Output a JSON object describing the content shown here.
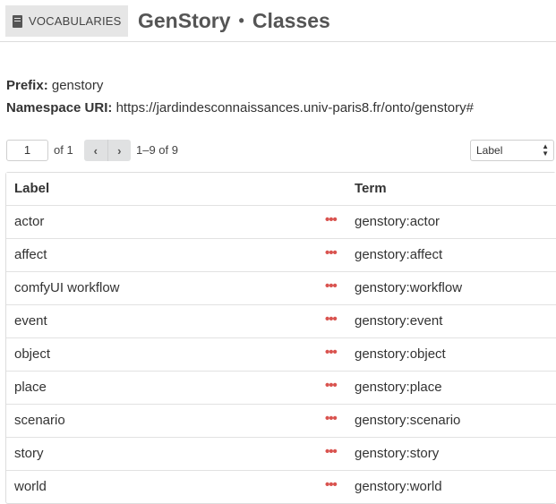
{
  "header": {
    "vocab_button_label": "VOCABULARIES",
    "title_name": "GenStory",
    "title_separator": "•",
    "title_section": "Classes"
  },
  "meta": {
    "prefix_label": "Prefix:",
    "prefix_value": "genstory",
    "namespace_label": "Namespace URI:",
    "namespace_value": "https://jardindesconnaissances.univ-paris8.fr/onto/genstory#"
  },
  "pager": {
    "page_value": "1",
    "of_text": "of 1",
    "prev_icon": "‹",
    "next_icon": "›",
    "range_text": "1–9 of 9",
    "sort_value": "Label"
  },
  "table": {
    "columns": [
      "Label",
      "Term"
    ],
    "more_glyph": "•••",
    "rows": [
      {
        "label": "actor",
        "term": "genstory:actor"
      },
      {
        "label": "affect",
        "term": "genstory:affect"
      },
      {
        "label": "comfyUI workflow",
        "term": "genstory:workflow"
      },
      {
        "label": "event",
        "term": "genstory:event"
      },
      {
        "label": "object",
        "term": "genstory:object"
      },
      {
        "label": "place",
        "term": "genstory:place"
      },
      {
        "label": "scenario",
        "term": "genstory:scenario"
      },
      {
        "label": "story",
        "term": "genstory:story"
      },
      {
        "label": "world",
        "term": "genstory:world"
      }
    ]
  },
  "colors": {
    "accent_more": "#d9534f",
    "title": "#555555"
  }
}
